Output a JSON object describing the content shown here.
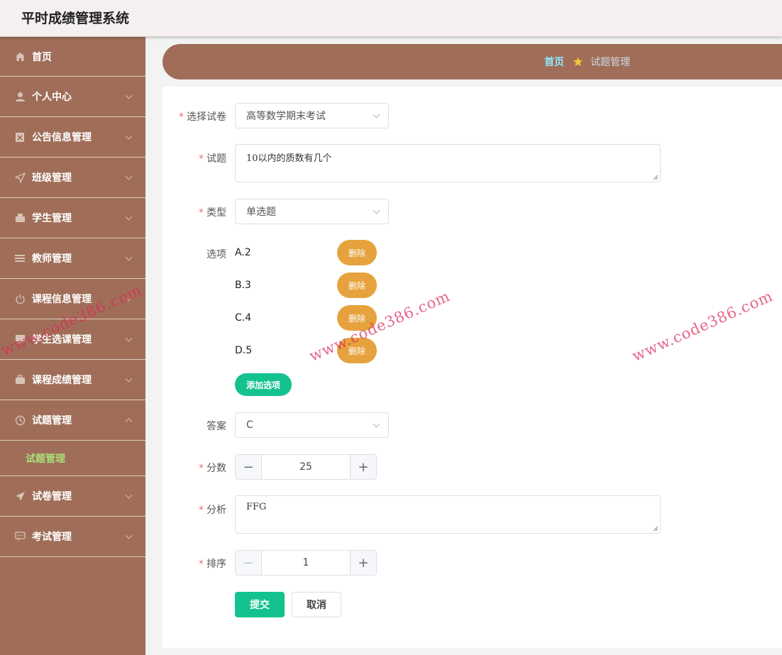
{
  "app": {
    "title": "平时成绩管理系统"
  },
  "sidebar": {
    "items": [
      {
        "label": "首页",
        "icon": "home-icon"
      },
      {
        "label": "个人中心",
        "icon": "user-icon"
      },
      {
        "label": "公告信息管理",
        "icon": "notice-icon"
      },
      {
        "label": "班级管理",
        "icon": "send-icon"
      },
      {
        "label": "学生管理",
        "icon": "shop-icon"
      },
      {
        "label": "教师管理",
        "icon": "list-icon"
      },
      {
        "label": "课程信息管理",
        "icon": "power-icon"
      },
      {
        "label": "学生选课管理",
        "icon": "monitor-icon"
      },
      {
        "label": "课程成绩管理",
        "icon": "briefcase-icon"
      },
      {
        "label": "试题管理",
        "icon": "clock-icon"
      },
      {
        "label": "试卷管理",
        "icon": "paper-plane-icon"
      },
      {
        "label": "考试管理",
        "icon": "chat-icon"
      }
    ],
    "active_submenu": "试题管理"
  },
  "breadcrumb": {
    "home": "首页",
    "current": "试题管理"
  },
  "form": {
    "paper": {
      "label": "选择试卷",
      "value": "高等数学期末考试"
    },
    "question": {
      "label": "试题",
      "value": "10以内的质数有几个"
    },
    "type": {
      "label": "类型",
      "value": "单选题"
    },
    "options": {
      "label": "选项",
      "items": [
        "A.2",
        "B.3",
        "C.4",
        "D.5"
      ],
      "delete_label": "删除",
      "add_label": "添加选项"
    },
    "answer": {
      "label": "答案",
      "value": "C"
    },
    "score": {
      "label": "分数",
      "value": "25"
    },
    "analysis": {
      "label": "分析",
      "value": "FFG"
    },
    "order": {
      "label": "排序",
      "value": "1"
    },
    "submit_label": "提交",
    "cancel_label": "取消"
  },
  "watermark": "www.code386.com",
  "colors": {
    "sidebar": "#a06e58",
    "accent_green": "#13c28e",
    "delete_orange": "#e6a23c",
    "submenu_active": "#a8e07a",
    "breadcrumb_home": "#8fe6ff"
  }
}
